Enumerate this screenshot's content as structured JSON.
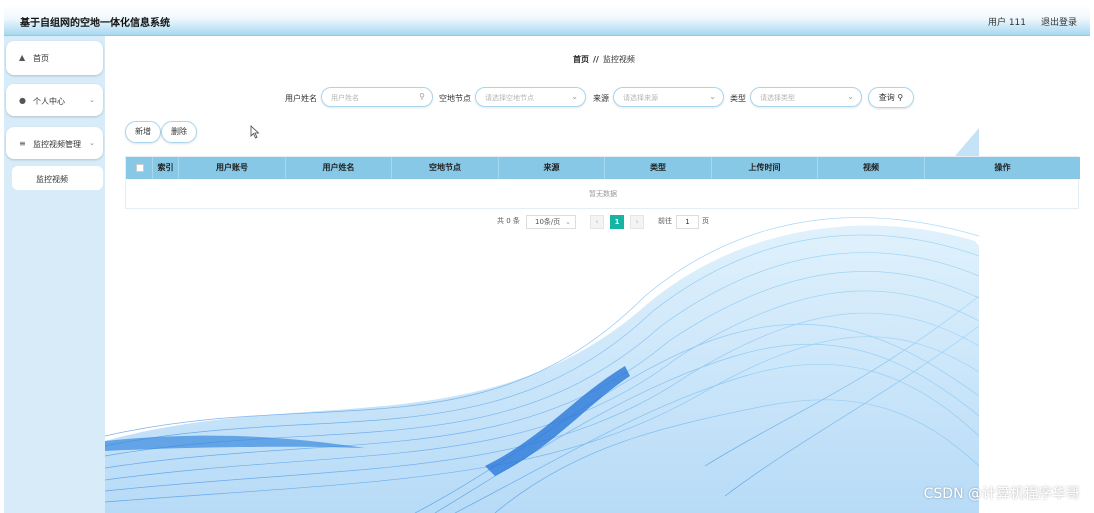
{
  "header": {
    "title": "基于自组网的空地一体化信息系统",
    "user": "用户 111",
    "logout": "退出登录"
  },
  "sidebar": {
    "home": {
      "icon": "home-icon",
      "label": "首页"
    },
    "personal": {
      "icon": "user-icon",
      "label": "个人中心"
    },
    "video_mgmt": {
      "icon": "list-icon",
      "label": "监控视频管理"
    },
    "video_sub": {
      "label": "监控视频"
    }
  },
  "breadcrumb": {
    "home": "首页",
    "sep": "//",
    "current": "监控视频"
  },
  "search": {
    "username_label": "用户姓名",
    "username_placeholder": "用户姓名",
    "node_label": "空地节点",
    "node_placeholder": "请选择空地节点",
    "source_label": "来源",
    "source_placeholder": "请选择来源",
    "type_label": "类型",
    "type_placeholder": "请选择类型",
    "query_label": "查询"
  },
  "actions": {
    "add": "新增",
    "delete": "删除"
  },
  "table": {
    "columns": [
      "索引",
      "用户账号",
      "用户姓名",
      "空地节点",
      "来源",
      "类型",
      "上传时间",
      "视频",
      "操作"
    ],
    "empty": "暂无数据"
  },
  "pagination": {
    "total": "共 0 条",
    "page_size": "10条/页",
    "current": "1",
    "goto": "前往",
    "goto_value": "1",
    "page_unit": "页"
  },
  "watermark": "CSDN @计算机程序华哥",
  "colors": {
    "header_bg": "#a6d8f1",
    "table_header": "#86c8e6",
    "page_active": "#17b3a3",
    "sidebar_bg": "#d7ecf8"
  }
}
